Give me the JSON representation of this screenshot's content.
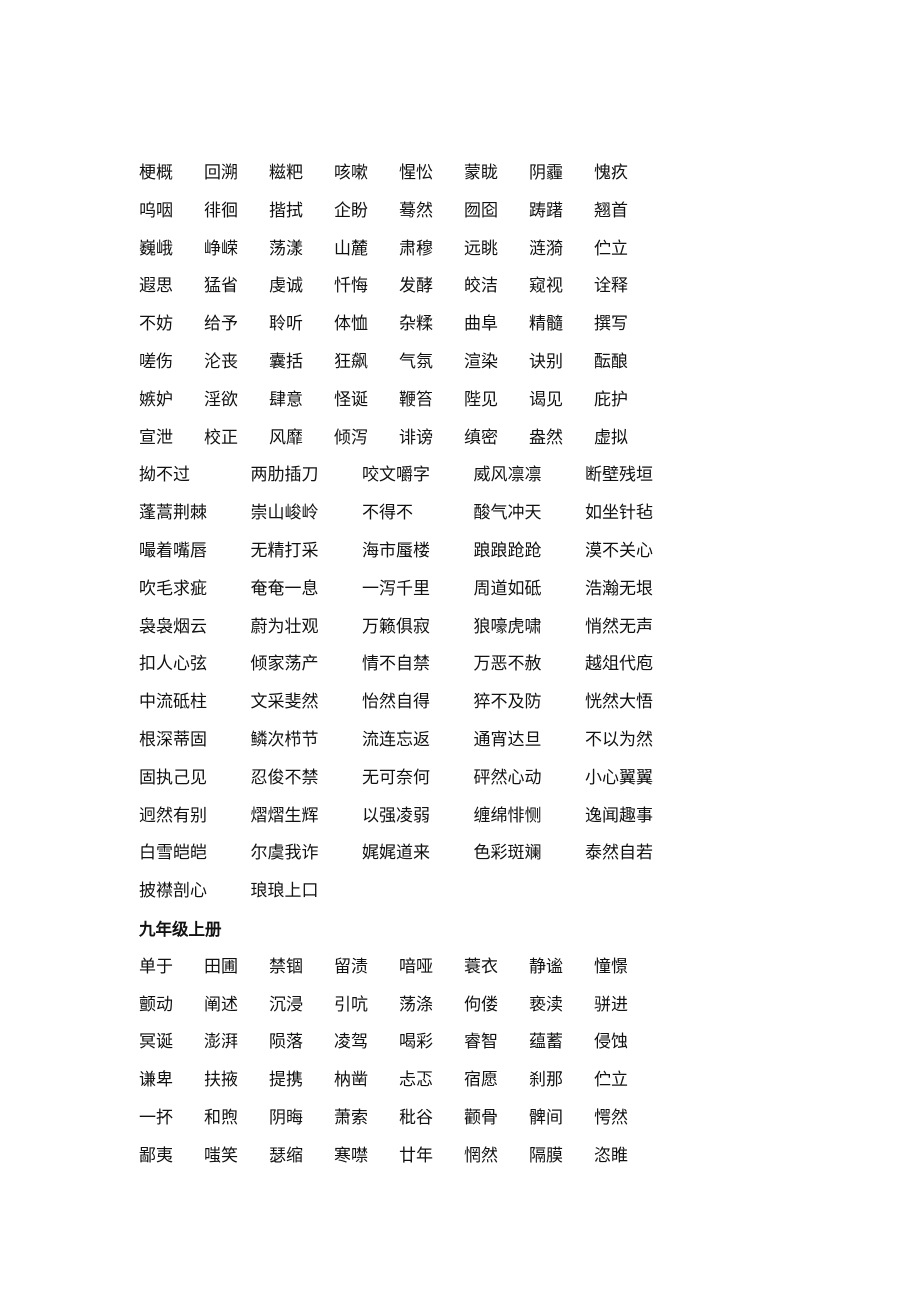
{
  "section1": {
    "rows2": [
      [
        "梗概",
        "回溯",
        "糍粑",
        "咳嗽",
        "惺忪",
        "蒙眬",
        "阴霾",
        "愧疚"
      ],
      [
        "呜咽",
        "徘徊",
        "揩拭",
        "企盼",
        "蓦然",
        "囫囵",
        "踌躇",
        "翘首"
      ],
      [
        "巍峨",
        "峥嵘",
        "荡漾",
        "山麓",
        "肃穆",
        "远眺",
        "涟漪",
        "伫立"
      ],
      [
        "遐思",
        "猛省",
        "虔诚",
        "忏悔",
        "发酵",
        "皎洁",
        "窥视",
        "诠释"
      ],
      [
        "不妨",
        "给予",
        "聆听",
        "体恤",
        "杂糅",
        "曲阜",
        "精髓",
        "撰写"
      ],
      [
        "嗟伤",
        "沦丧",
        "囊括",
        "狂飙",
        "气氛",
        "渲染",
        "诀别",
        "酝酿"
      ],
      [
        "嫉妒",
        "淫欲",
        "肆意",
        "怪诞",
        "鞭笞",
        "陛见",
        "谒见",
        "庇护"
      ],
      [
        "宣泄",
        "校正",
        "风靡",
        "倾泻",
        "诽谤",
        "缜密",
        "盎然",
        "虚拟"
      ]
    ],
    "rows4": [
      [
        "拗不过",
        "两肋插刀",
        "咬文嚼字",
        "威风凛凛",
        "断壁残垣"
      ],
      [
        "蓬蒿荆棘",
        "崇山峻岭",
        "不得不",
        "酸气冲天",
        "如坐针毡"
      ],
      [
        "嘬着嘴唇",
        "无精打采",
        "海市蜃楼",
        "踉踉跄跄",
        "漠不关心"
      ],
      [
        "吹毛求疵",
        "奄奄一息",
        "一泻千里",
        "周道如砥",
        "浩瀚无垠"
      ],
      [
        "袅袅烟云",
        "蔚为壮观",
        "万籁俱寂",
        "狼嚎虎啸",
        "悄然无声"
      ],
      [
        "扣人心弦",
        "倾家荡产",
        "情不自禁",
        "万恶不赦",
        "越俎代庖"
      ],
      [
        "中流砥柱",
        "文采斐然",
        "怡然自得",
        "猝不及防",
        "恍然大悟"
      ],
      [
        "根深蒂固",
        "鳞次栉节",
        "流连忘返",
        "通宵达旦",
        "不以为然"
      ],
      [
        "固执己见",
        "忍俊不禁",
        "无可奈何",
        "砰然心动",
        "小心翼翼"
      ],
      [
        "迥然有别",
        "熠熠生辉",
        "以强凌弱",
        "缠绵悱恻",
        "逸闻趣事"
      ],
      [
        "白雪皑皑",
        "尔虞我诈",
        "娓娓道来",
        "色彩斑斓",
        "泰然自若"
      ],
      [
        "披襟剖心",
        "琅琅上口"
      ]
    ]
  },
  "section2": {
    "heading": "九年级上册",
    "rows2": [
      [
        "单于",
        "田圃",
        "禁锢",
        "留渍",
        "喑哑",
        "蓑衣",
        "静谧",
        "憧憬"
      ],
      [
        "颤动",
        "阐述",
        "沉浸",
        "引吭",
        "荡涤",
        "佝偻",
        "亵渎",
        "骈进"
      ],
      [
        "冥诞",
        "澎湃",
        "陨落",
        "凌驾",
        "喝彩",
        "睿智",
        "蕴蓄",
        "侵蚀"
      ],
      [
        "谦卑",
        "扶掖",
        "提携",
        "枘凿",
        "忐忑",
        "宿愿",
        "刹那",
        "伫立"
      ],
      [
        "一抔",
        "和煦",
        "阴晦",
        "萧索",
        "秕谷",
        "颧骨",
        "髀间",
        "愕然"
      ],
      [
        "鄙夷",
        "嗤笑",
        "瑟缩",
        "寒噤",
        "廿年",
        "惘然",
        "隔膜",
        "恣睢"
      ]
    ]
  }
}
